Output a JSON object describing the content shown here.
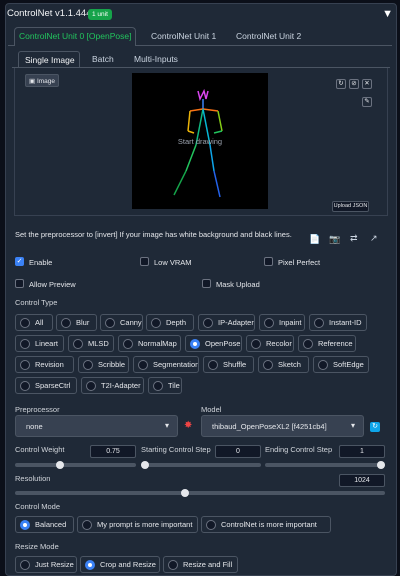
{
  "header": {
    "title": "ControlNet v1.1.444",
    "badge": "1 unit",
    "collapse_icon": "▼"
  },
  "unit_tabs": [
    "ControlNet Unit 0 [OpenPose]",
    "ControlNet Unit 1",
    "ControlNet Unit 2"
  ],
  "image_tabs": [
    "Single Image",
    "Batch",
    "Multi-Inputs"
  ],
  "canvas": {
    "image_label": "Image",
    "start_text": "Start drawing",
    "upload_json": "Upload JSON",
    "tool_icons": [
      "↻",
      "⊘",
      "✕"
    ],
    "brush_icon": "✎"
  },
  "hint": "Set the preprocessor to [invert] If your image has white background and black lines.",
  "action_icons": [
    "📄",
    "📷",
    "⇄",
    "↗"
  ],
  "checks": {
    "enable": "Enable",
    "low_vram": "Low VRAM",
    "pixel_perfect": "Pixel Perfect",
    "allow_preview": "Allow Preview",
    "mask_upload": "Mask Upload"
  },
  "control_type": {
    "label": "Control Type",
    "options": [
      "All",
      "Blur",
      "Canny",
      "Depth",
      "IP-Adapter",
      "Inpaint",
      "Instant-ID",
      "Lineart",
      "MLSD",
      "NormalMap",
      "OpenPose",
      "Recolor",
      "Reference",
      "Revision",
      "Scribble",
      "Segmentation",
      "Shuffle",
      "Sketch",
      "SoftEdge",
      "SparseCtrl",
      "T2I-Adapter",
      "Tile"
    ],
    "selected": "OpenPose"
  },
  "preprocessor": {
    "label": "Preprocessor",
    "value": "none"
  },
  "model": {
    "label": "Model",
    "value": "thibaud_OpenPoseXL2 [f4251cb4]"
  },
  "sliders": {
    "weight": {
      "label": "Control Weight",
      "value": "0.75",
      "fraction": 0.375
    },
    "start": {
      "label": "Starting Control Step",
      "value": "0",
      "fraction": 0.0
    },
    "end": {
      "label": "Ending Control Step",
      "value": "1",
      "fraction": 1.0
    },
    "resolution": {
      "label": "Resolution",
      "value": "1024",
      "fraction": 0.46
    }
  },
  "control_mode": {
    "label": "Control Mode",
    "options": [
      "Balanced",
      "My prompt is more important",
      "ControlNet is more important"
    ],
    "selected": "Balanced"
  },
  "resize_mode": {
    "label": "Resize Mode",
    "options": [
      "Just Resize",
      "Crop and Resize",
      "Resize and Fill"
    ],
    "selected": "Crop and Resize"
  }
}
